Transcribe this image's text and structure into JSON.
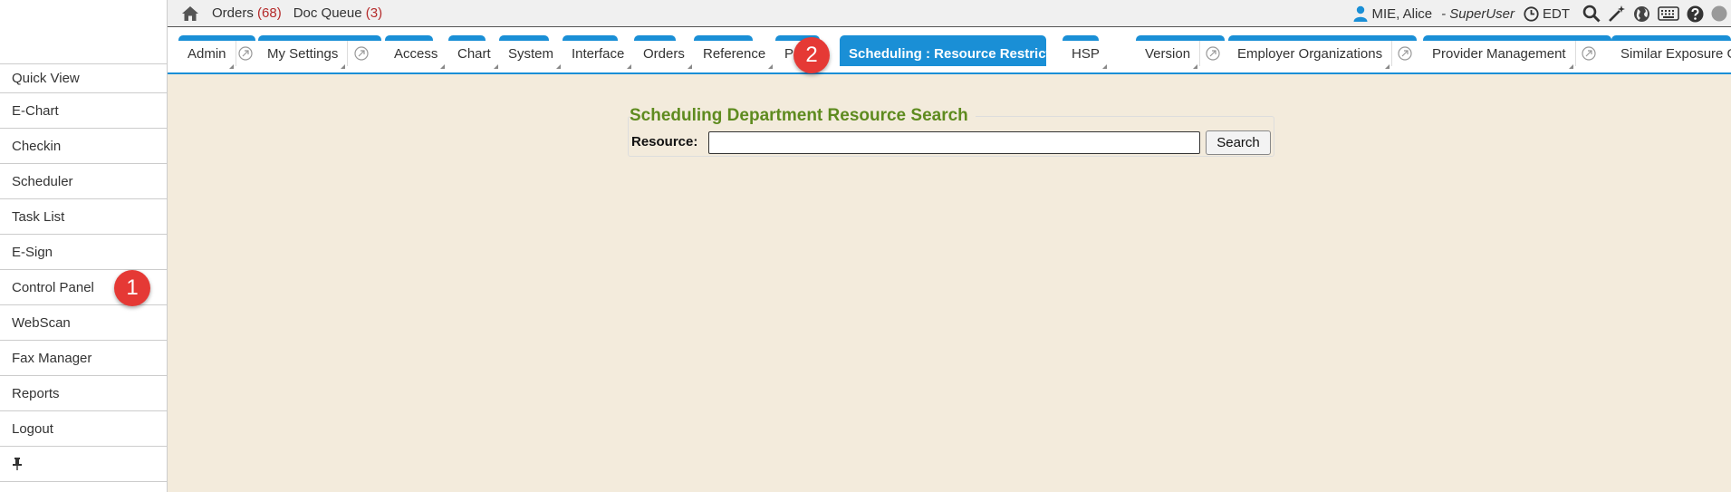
{
  "topbar": {
    "orders_label": "Orders",
    "orders_count": "(68)",
    "docqueue_label": "Doc Queue",
    "docqueue_count": "(3)",
    "user_name": "MIE, Alice",
    "user_role": "- SuperUser",
    "timezone": "EDT",
    "icons": [
      "home-icon",
      "user-icon",
      "clock-icon",
      "search-icon",
      "wand-icon",
      "globe-icon",
      "keyboard-icon",
      "help-icon",
      "status-icon"
    ]
  },
  "sidebar": {
    "items": [
      {
        "label": "Quick View"
      },
      {
        "label": "E-Chart"
      },
      {
        "label": "Checkin"
      },
      {
        "label": "Scheduler"
      },
      {
        "label": "Task List"
      },
      {
        "label": "E-Sign"
      },
      {
        "label": "Control Panel"
      },
      {
        "label": "WebScan"
      },
      {
        "label": "Fax Manager"
      },
      {
        "label": "Reports"
      },
      {
        "label": "Logout"
      }
    ],
    "pin_icon": "pin-icon"
  },
  "tabs": [
    {
      "label": "Admin"
    },
    {
      "label": "My Settings"
    },
    {
      "label": "Access"
    },
    {
      "label": "Chart"
    },
    {
      "label": "System"
    },
    {
      "label": "Interface"
    },
    {
      "label": "Orders"
    },
    {
      "label": "Reference"
    },
    {
      "label": "Pr"
    },
    {
      "label": "Scheduling : Resource Restrictions"
    },
    {
      "label": "HSP"
    },
    {
      "label": "Version"
    },
    {
      "label": "Employer Organizations"
    },
    {
      "label": "Provider Management"
    },
    {
      "label": "Similar Exposure Gr"
    }
  ],
  "annotations": [
    "1",
    "2"
  ],
  "main": {
    "legend": "Scheduling Department Resource Search",
    "resource_label": "Resource:",
    "resource_value": "",
    "search_button": "Search"
  },
  "colors": {
    "accent": "#1a8fd6",
    "background": "#f3ebdc",
    "legend": "#5e8b1f",
    "count": "#b52b2b",
    "badge": "#e53935"
  }
}
